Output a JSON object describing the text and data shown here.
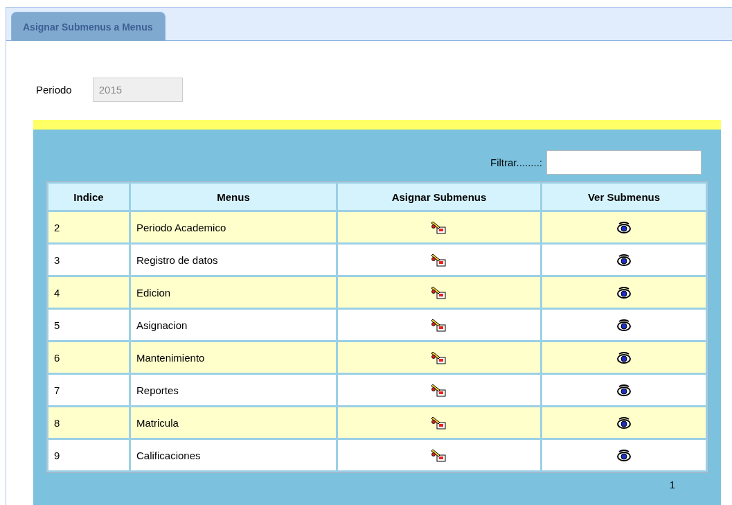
{
  "tabs": [
    {
      "label": "Asignar Submenus a Menus",
      "selected": true
    }
  ],
  "periodo": {
    "label": "Periodo",
    "value": "2015"
  },
  "filter": {
    "label": "Filtrar........:"
  },
  "table": {
    "columns": [
      "Indice",
      "Menus",
      "Asignar Submenus",
      "Ver Submenus"
    ],
    "rows": [
      {
        "indice": "2",
        "menu": "Periodo Academico"
      },
      {
        "indice": "3",
        "menu": "Registro de datos"
      },
      {
        "indice": "4",
        "menu": "Edicion"
      },
      {
        "indice": "5",
        "menu": "Asignacion"
      },
      {
        "indice": "6",
        "menu": "Mantenimiento"
      },
      {
        "indice": "7",
        "menu": "Reportes"
      },
      {
        "indice": "8",
        "menu": "Matricula"
      },
      {
        "indice": "9",
        "menu": "Calificaciones"
      }
    ]
  },
  "pager": {
    "page": "1"
  }
}
